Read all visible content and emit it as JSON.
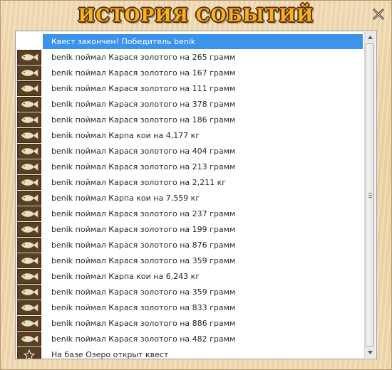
{
  "window": {
    "title": "ИСТОРИЯ СОБЫТИЙ",
    "close_label": "X"
  },
  "events": [
    {
      "text": "Квест закончен! Победитель benik",
      "icon": "none",
      "selected": true
    },
    {
      "text": "benik поймал Карася золотого на 265 грамм",
      "icon": "fish-icon"
    },
    {
      "text": "benik поймал Карася золотого на 167 грамм",
      "icon": "fish-icon"
    },
    {
      "text": "benik поймал Карася золотого на 111 грамм",
      "icon": "fish-icon"
    },
    {
      "text": "benik поймал Карася золотого на 378 грамм",
      "icon": "fish-icon"
    },
    {
      "text": "benik поймал Карася золотого на 186 грамм",
      "icon": "fish-icon"
    },
    {
      "text": "benik поймал Карпа кои на 4,177 кг",
      "icon": "fish-icon"
    },
    {
      "text": "benik поймал Карася золотого на 404 грамм",
      "icon": "fish-icon"
    },
    {
      "text": "benik поймал Карася золотого на 213 грамм",
      "icon": "fish-icon"
    },
    {
      "text": "benik поймал Карася золотого на 2,211 кг",
      "icon": "fish-icon"
    },
    {
      "text": "benik поймал Карпа кои на 7,559 кг",
      "icon": "fish-icon"
    },
    {
      "text": "benik поймал Карася золотого на 237 грамм",
      "icon": "fish-icon"
    },
    {
      "text": "benik поймал Карася золотого на 199 грамм",
      "icon": "fish-icon"
    },
    {
      "text": "benik поймал Карася золотого на 876 грамм",
      "icon": "fish-icon"
    },
    {
      "text": "benik поймал Карася золотого на 359 грамм",
      "icon": "fish-icon"
    },
    {
      "text": "benik поймал Карпа кои на 6,243 кг",
      "icon": "fish-icon"
    },
    {
      "text": "benik поймал Карася золотого на 359 грамм",
      "icon": "fish-icon"
    },
    {
      "text": "benik поймал Карася золотого на 833 грамм",
      "icon": "fish-icon"
    },
    {
      "text": "benik поймал Карася золотого на 886 грамм",
      "icon": "fish-icon"
    },
    {
      "text": "benik поймал Карася золотого на 482 грамм",
      "icon": "fish-icon"
    },
    {
      "text": "На базе Озеро открыт квест",
      "icon": "quest-icon"
    }
  ],
  "colors": {
    "selection": "#3c93ea",
    "icon_background": "#5a3f22",
    "fish_icon": "#e9e0c6",
    "title": "#f5b31d"
  }
}
